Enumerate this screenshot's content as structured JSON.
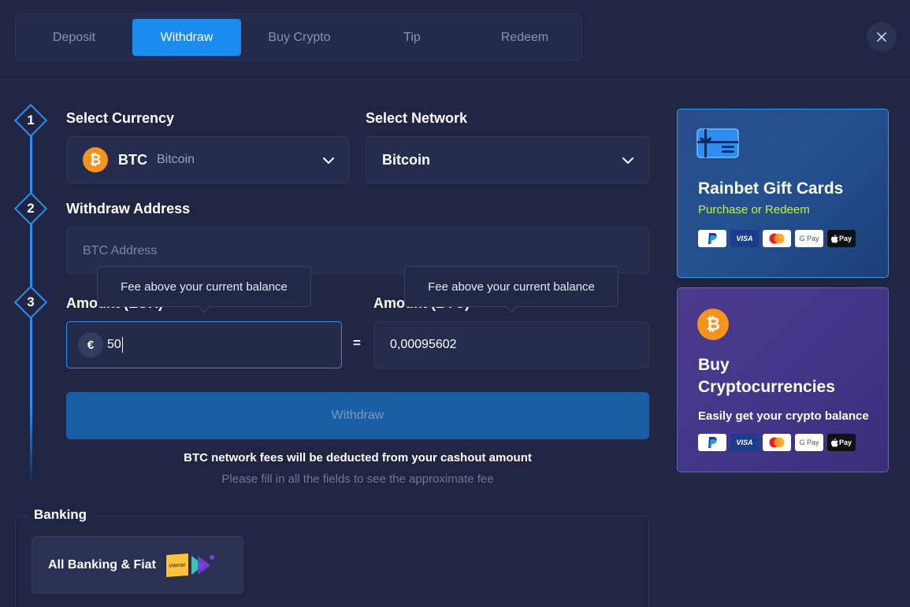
{
  "tabs": [
    {
      "label": "Deposit",
      "active": false
    },
    {
      "label": "Withdraw",
      "active": true
    },
    {
      "label": "Buy Crypto",
      "active": false
    },
    {
      "label": "Tip",
      "active": false
    },
    {
      "label": "Redeem",
      "active": false
    }
  ],
  "steps": [
    "1",
    "2",
    "3"
  ],
  "currency": {
    "label": "Select Currency",
    "code": "BTC",
    "name": "Bitcoin",
    "icon": "bitcoin-icon"
  },
  "network": {
    "label": "Select Network",
    "value": "Bitcoin"
  },
  "address": {
    "label": "Withdraw Address",
    "placeholder": "BTC Address"
  },
  "amount_fiat": {
    "label": "Amount (EUR)",
    "symbol": "€",
    "value": "50",
    "tooltip": "Fee above your current balance"
  },
  "equals": "=",
  "amount_crypto": {
    "label": "Amount (BTC)",
    "value": "0,00095602",
    "tooltip": "Fee above your current balance"
  },
  "withdraw_button": "Withdraw",
  "fee_note": "BTC network fees will be deducted from your cashout amount",
  "fee_hint": "Please fill in all the fields to see the approximate fee",
  "gift_card": {
    "title": "Rainbet Gift Cards",
    "subtitle": "Purchase or Redeem",
    "accent": "#c6f03c"
  },
  "crypto_card": {
    "title_line1": "Buy",
    "title_line2": "Cryptocurrencies",
    "subtitle": "Easily get your crypto balance"
  },
  "payment_methods": [
    {
      "name": "paypal-icon"
    },
    {
      "name": "visa-icon",
      "label": "VISA"
    },
    {
      "name": "mastercard-icon"
    },
    {
      "name": "google-pay-icon",
      "label": "G Pay"
    },
    {
      "name": "apple-pay-icon",
      "label": "Pay"
    }
  ],
  "banking": {
    "section_label": "Banking",
    "button_label": "All Banking & Fiat",
    "interac_label": "Interac"
  },
  "colors": {
    "accent": "#1a8cf0",
    "bitcoin": "#f7931a",
    "background": "#1f2543"
  }
}
